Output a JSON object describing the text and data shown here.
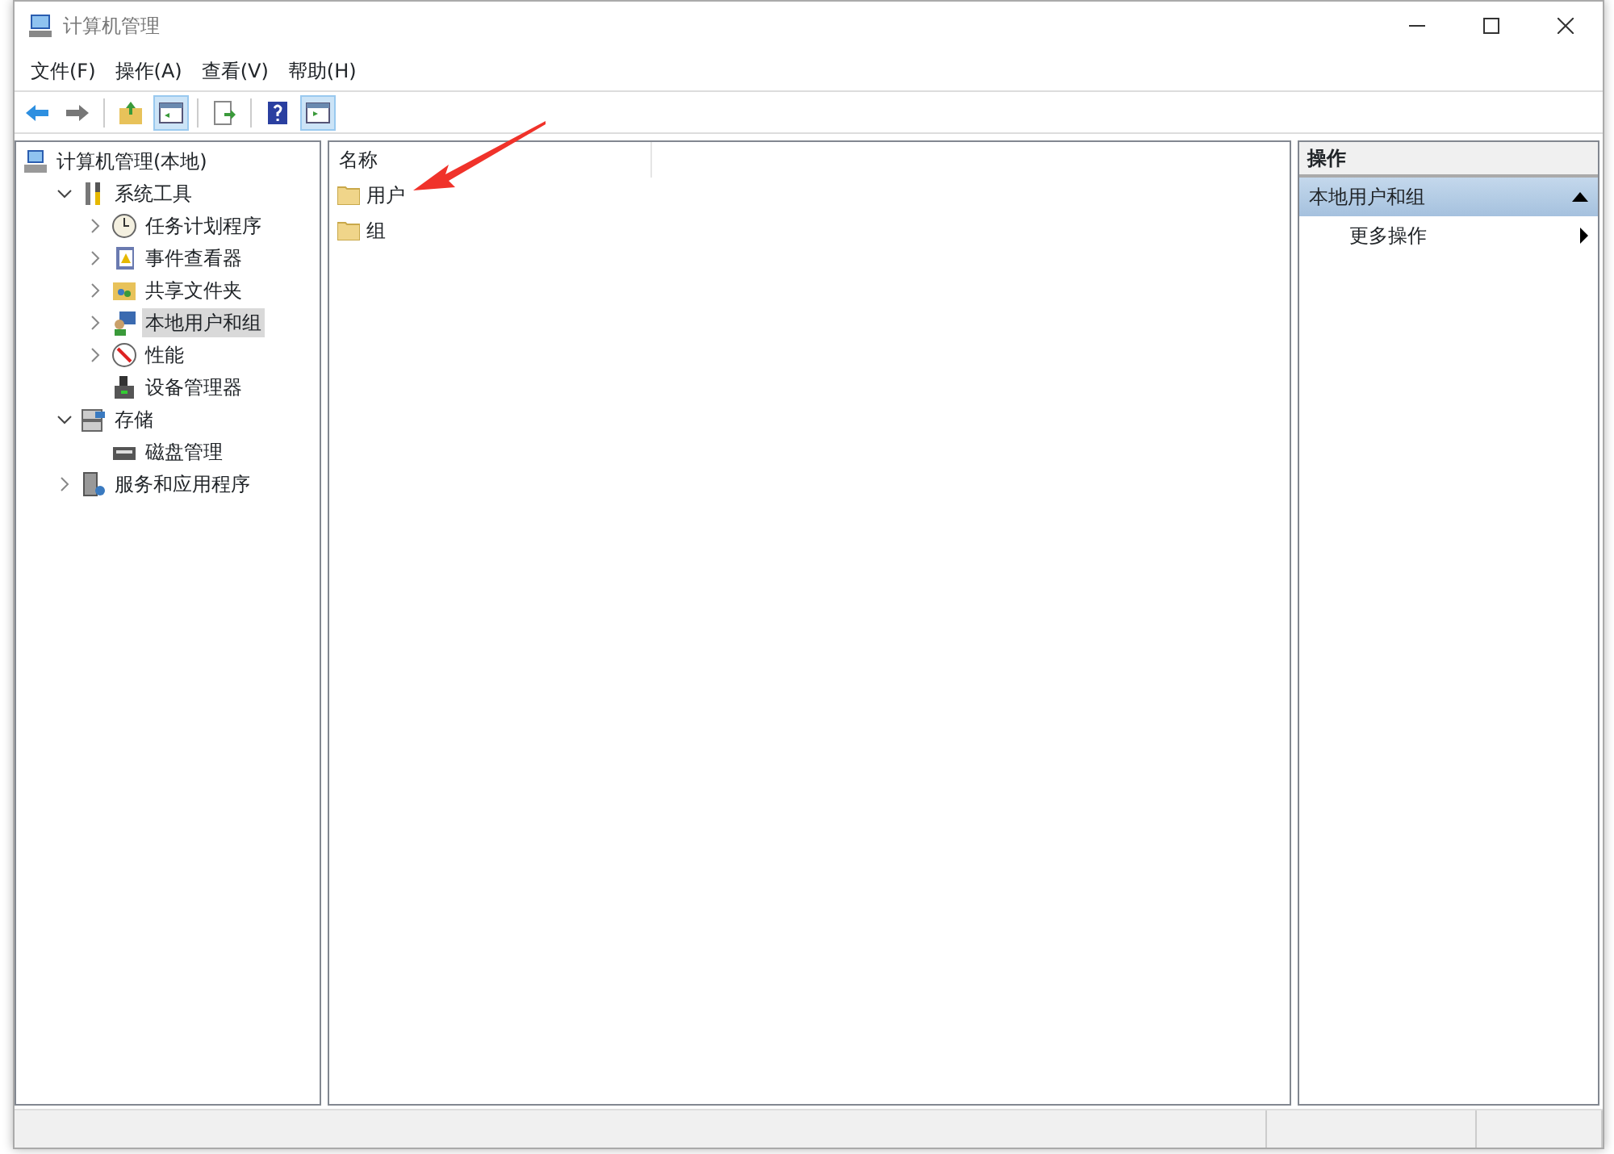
{
  "window": {
    "title": "计算机管理"
  },
  "menu": [
    "文件(F)",
    "操作(A)",
    "查看(V)",
    "帮助(H)"
  ],
  "toolbar": [
    {
      "pressed": false
    },
    {
      "pressed": false
    },
    {
      "pressed": false
    },
    {
      "pressed": true
    },
    {
      "pressed": false
    },
    {
      "pressed": false
    },
    {
      "pressed": true
    }
  ],
  "tree": [
    {
      "label": "计算机管理(本地)",
      "selected": false,
      "children": [
        {
          "label": "系统工具",
          "expanded": true,
          "selected": false,
          "children": [
            {
              "label": "任务计划程序",
              "expanded": false,
              "selected": false
            },
            {
              "label": "事件查看器",
              "expanded": false,
              "selected": false
            },
            {
              "label": "共享文件夹",
              "expanded": false,
              "selected": false
            },
            {
              "label": "本地用户和组",
              "expanded": false,
              "selected": true
            },
            {
              "label": "性能",
              "expanded": false,
              "selected": false
            },
            {
              "label": "设备管理器",
              "selected": false
            }
          ]
        },
        {
          "label": "存储",
          "expanded": true,
          "selected": false,
          "children": [
            {
              "label": "磁盘管理",
              "selected": false
            }
          ]
        },
        {
          "label": "服务和应用程序",
          "expanded": false,
          "selected": false
        }
      ]
    }
  ],
  "list": {
    "column": "名称",
    "items": [
      "用户",
      "组"
    ]
  },
  "actions": {
    "header": "操作",
    "section": {
      "label": "本地用户和组",
      "expanded": true
    },
    "items": [
      "更多操作"
    ]
  }
}
